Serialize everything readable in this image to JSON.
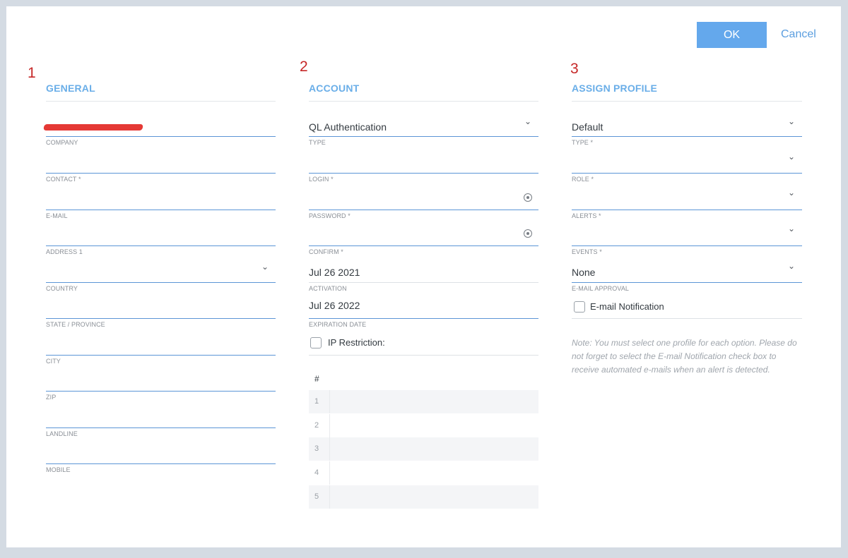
{
  "actions": {
    "ok_label": "OK",
    "cancel_label": "Cancel"
  },
  "markers": [
    "1",
    "2",
    "3"
  ],
  "general": {
    "title": "GENERAL",
    "company": "",
    "labels": {
      "company": "COMPANY",
      "contact": "CONTACT *",
      "email": "E-MAIL",
      "address1": "ADDRESS 1",
      "country": "COUNTRY",
      "state": "STATE / PROVINCE",
      "city": "CITY",
      "zip": "ZIP",
      "landline": "LANDLINE",
      "mobile": "MOBILE"
    }
  },
  "account": {
    "title": "ACCOUNT",
    "type_value": "QL Authentication",
    "activation_value": "Jul 26 2021",
    "expiration_value": "Jul 26 2022",
    "ip_restriction_label": "IP Restriction:",
    "labels": {
      "type": "TYPE",
      "login": "LOGIN *",
      "password": "PASSWORD *",
      "confirm": "CONFIRM *",
      "activation": "ACTIVATION",
      "expiration": "EXPIRATION DATE"
    },
    "table": {
      "header": "#",
      "rows": [
        "1",
        "2",
        "3",
        "4",
        "5"
      ]
    }
  },
  "profile": {
    "title": "ASSIGN PROFILE",
    "type_value": "Default",
    "email_approval_value": "None",
    "email_notification_label": "E-mail Notification",
    "labels": {
      "type": "TYPE *",
      "role": "ROLE *",
      "alerts": "ALERTS *",
      "events": "EVENTS *",
      "email_approval": "E-MAIL APPROVAL"
    },
    "note": "Note: You must select one profile for each option. Please do not forget to select the E-mail Notification check box to receive automated e-mails when an alert is detected."
  },
  "colors": {
    "accent": "#64a8ec",
    "title": "#6aaee8",
    "marker": "#c62828",
    "underline": "#5b95d6"
  }
}
